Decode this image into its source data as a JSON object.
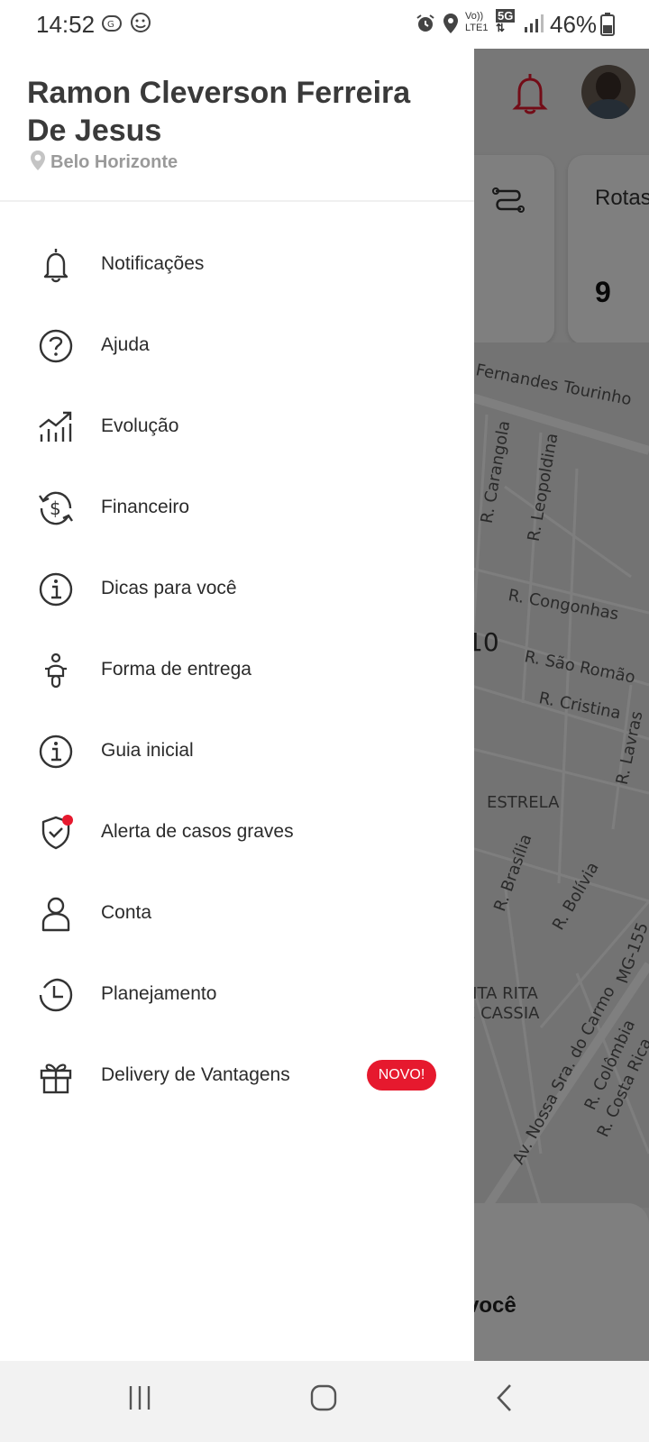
{
  "status_bar": {
    "time": "14:52",
    "network_top": "Vo))",
    "network_bottom": "LTE1",
    "network_5g": "5G",
    "battery": "46%"
  },
  "drawer": {
    "user_name": "Ramon Cleverson Ferreira De Jesus",
    "location": "Belo Horizonte",
    "menu": [
      {
        "label": "Notificações",
        "icon": "bell-icon"
      },
      {
        "label": "Ajuda",
        "icon": "help-circle-icon"
      },
      {
        "label": "Evolução",
        "icon": "chart-growth-icon"
      },
      {
        "label": "Financeiro",
        "icon": "money-cycle-icon"
      },
      {
        "label": "Dicas para você",
        "icon": "info-circle-icon"
      },
      {
        "label": "Forma de entrega",
        "icon": "scooter-icon"
      },
      {
        "label": "Guia inicial",
        "icon": "info-circle-icon"
      },
      {
        "label": "Alerta de casos graves",
        "icon": "shield-check-icon"
      },
      {
        "label": "Conta",
        "icon": "user-icon"
      },
      {
        "label": "Planejamento",
        "icon": "clock-icon"
      },
      {
        "label": "Delivery de Vantagens",
        "icon": "gift-icon",
        "badge": "NOVO!"
      }
    ]
  },
  "background": {
    "card_title": "Rotas",
    "card_value": "9",
    "map_streets": [
      "Fernandes Tourinho",
      "R. Carangola",
      "R. Leopoldina",
      "R. Congonhas",
      "R. São Romão",
      "R. Cristina",
      "R. Lavras",
      "ESTRELA",
      "R. Brasília",
      "R. Bolívia",
      "MG-155",
      "NTA RITA",
      "E CASSIA",
      "Av. Nossa Sra. do Carmo",
      "R. Colômbia",
      "R. Costa Rica"
    ],
    "map_partial_text": "10",
    "bottom_text": "você"
  },
  "colors": {
    "accent": "#e6192e",
    "text_primary": "#2b2b2b",
    "text_muted": "#9a9a9a"
  }
}
